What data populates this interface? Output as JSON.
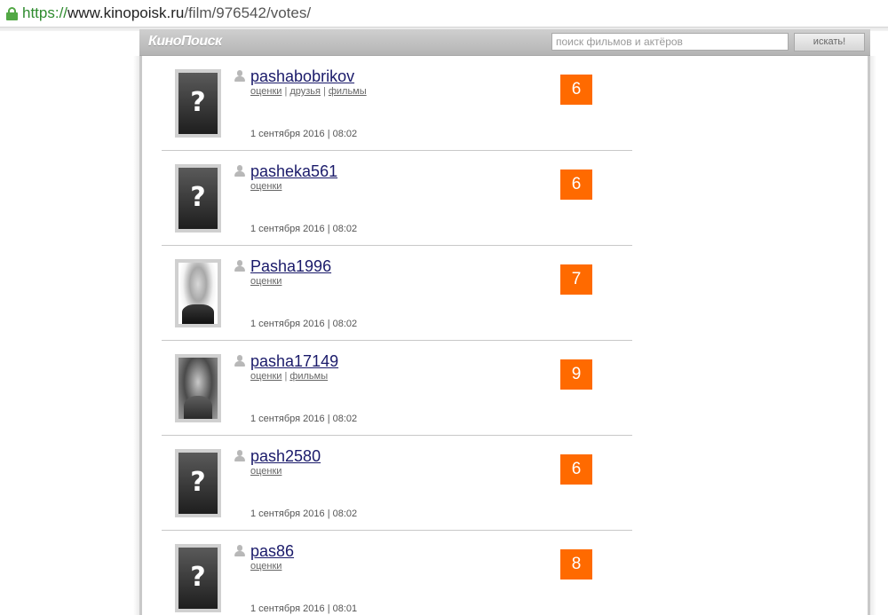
{
  "browser": {
    "url_scheme": "https://",
    "url_host": "www.kinopoisk.ru",
    "url_path": "/film/976542/votes/"
  },
  "site": {
    "logo": "КиноПоиск",
    "search_placeholder": "поиск фильмов и актёров",
    "search_button": "искать!"
  },
  "users": [
    {
      "name": "pashabobrikov",
      "links": [
        "оценки",
        "друзья",
        "фильмы"
      ],
      "date": "1 сентября 2016 | 08:02",
      "score": "6",
      "avatar": "placeholder"
    },
    {
      "name": "pasheka561",
      "links": [
        "оценки"
      ],
      "date": "1 сентября 2016 | 08:02",
      "score": "6",
      "avatar": "placeholder"
    },
    {
      "name": "Pasha1996",
      "links": [
        "оценки"
      ],
      "date": "1 сентября 2016 | 08:02",
      "score": "7",
      "avatar": "photo"
    },
    {
      "name": "pasha17149",
      "links": [
        "оценки",
        "фильмы"
      ],
      "date": "1 сентября 2016 | 08:02",
      "score": "9",
      "avatar": "photo"
    },
    {
      "name": "pash2580",
      "links": [
        "оценки"
      ],
      "date": "1 сентября 2016 | 08:02",
      "score": "6",
      "avatar": "placeholder"
    },
    {
      "name": "pas86",
      "links": [
        "оценки"
      ],
      "date": "1 сентября 2016 | 08:01",
      "score": "8",
      "avatar": "placeholder"
    }
  ],
  "icons": {
    "lock": "lock-icon",
    "user": "user-icon",
    "avatar_placeholder_glyph": "?"
  },
  "colors": {
    "score_bg": "#ff6a00",
    "username": "#1a1a6a",
    "lock": "#52a845"
  }
}
